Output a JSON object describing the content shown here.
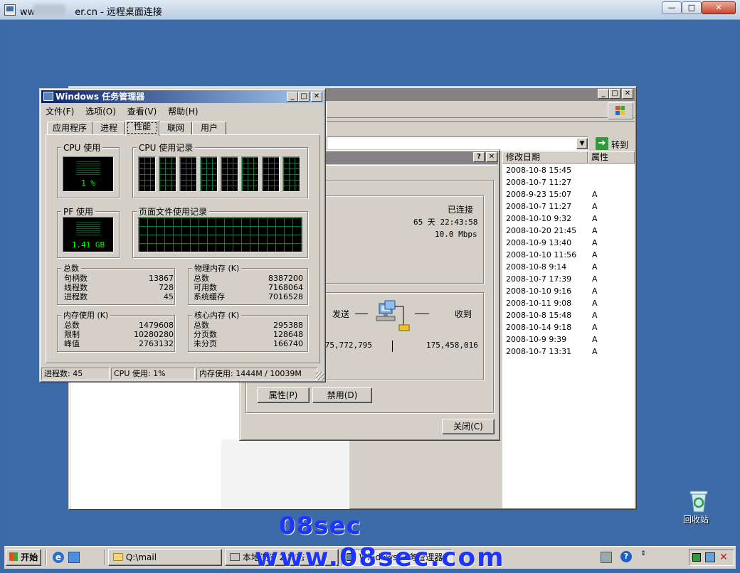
{
  "rdp": {
    "title_prefix": "ww",
    "title_suffix": "er.cn - 远程桌面连接",
    "minimize": "—",
    "maximize": "□",
    "close": "✕"
  },
  "explorer": {
    "address_go": "转到",
    "columns": [
      "修改日期",
      "属性"
    ],
    "rows": [
      {
        "date": "2008-10-8 15:45",
        "attr": ""
      },
      {
        "date": "2008-10-7 11:27",
        "attr": ""
      },
      {
        "date": "2008-9-23 15:07",
        "attr": "A"
      },
      {
        "date": "2008-10-7 11:27",
        "attr": "A"
      },
      {
        "date": "2008-10-10 9:32",
        "attr": "A"
      },
      {
        "date": "2008-10-20 21:45",
        "attr": "A"
      },
      {
        "date": "2008-10-9 13:40",
        "attr": "A"
      },
      {
        "date": "2008-10-10 11:56",
        "attr": "A"
      },
      {
        "date": "2008-10-8 9:14",
        "attr": "A"
      },
      {
        "date": "2008-10-7 17:39",
        "attr": "A"
      },
      {
        "date": "2008-10-10 9:16",
        "attr": "A"
      },
      {
        "date": "2008-10-11 9:08",
        "attr": "A"
      },
      {
        "date": "2008-10-8 15:48",
        "attr": "A"
      },
      {
        "date": "2008-10-14 9:18",
        "attr": "A"
      },
      {
        "date": "2008-10-9 9:39",
        "attr": "A"
      },
      {
        "date": "2008-10-7 13:31",
        "attr": "A"
      }
    ]
  },
  "conn": {
    "help": "?",
    "close_x": "✕",
    "status": "已连接",
    "duration": "65 天 22:43:58",
    "speed": "10.0 Mbps",
    "sent_label": "发送",
    "recv_label": "收到",
    "sent_bytes": "175,772,795",
    "recv_bytes": "175,458,016",
    "properties_btn": "属性(P)",
    "disable_btn": "禁用(D)",
    "close_btn": "关闭(C)"
  },
  "tm": {
    "title": "Windows 任务管理器",
    "menu": [
      "文件(F)",
      "选项(O)",
      "查看(V)",
      "帮助(H)"
    ],
    "tabs": [
      "应用程序",
      "进程",
      "性能",
      "联网",
      "用户"
    ],
    "cpu_usage_title": "CPU 使用",
    "cpu_usage_value": "1 %",
    "cpu_history_title": "CPU 使用记录",
    "pf_title": "PF 使用",
    "pf_value": "1.41 GB",
    "pf_history_title": "页面文件使用记录",
    "totals": {
      "title": "总数",
      "handles_label": "句柄数",
      "handles": "13867",
      "threads_label": "线程数",
      "threads": "728",
      "processes_label": "进程数",
      "processes": "45"
    },
    "physical": {
      "title": "物理内存 (K)",
      "total_label": "总数",
      "total": "8387200",
      "avail_label": "可用数",
      "avail": "7168064",
      "cache_label": "系统缓存",
      "cache": "7016528"
    },
    "commit": {
      "title": "内存使用 (K)",
      "total_label": "总数",
      "total": "1479608",
      "limit_label": "限制",
      "limit": "10280280",
      "peak_label": "峰值",
      "peak": "2763132"
    },
    "kernel": {
      "title": "核心内存 (K)",
      "total_label": "总数",
      "total": "295388",
      "paged_label": "分页数",
      "paged": "128648",
      "nonpaged_label": "未分页",
      "nonpaged": "166740"
    },
    "status": {
      "processes": "进程数: 45",
      "cpu": "CPU 使用: 1%",
      "memory": "内存使用: 1444M / 10039M"
    }
  },
  "desktop": {
    "recycle_bin": "回收站"
  },
  "taskbar": {
    "start": "开始",
    "items": [
      "Q:\\mail",
      "本地连接 2 状态",
      "Windows 任务管理器"
    ]
  },
  "watermark": {
    "line1": "08sec",
    "line2": "www.08sec.com"
  }
}
